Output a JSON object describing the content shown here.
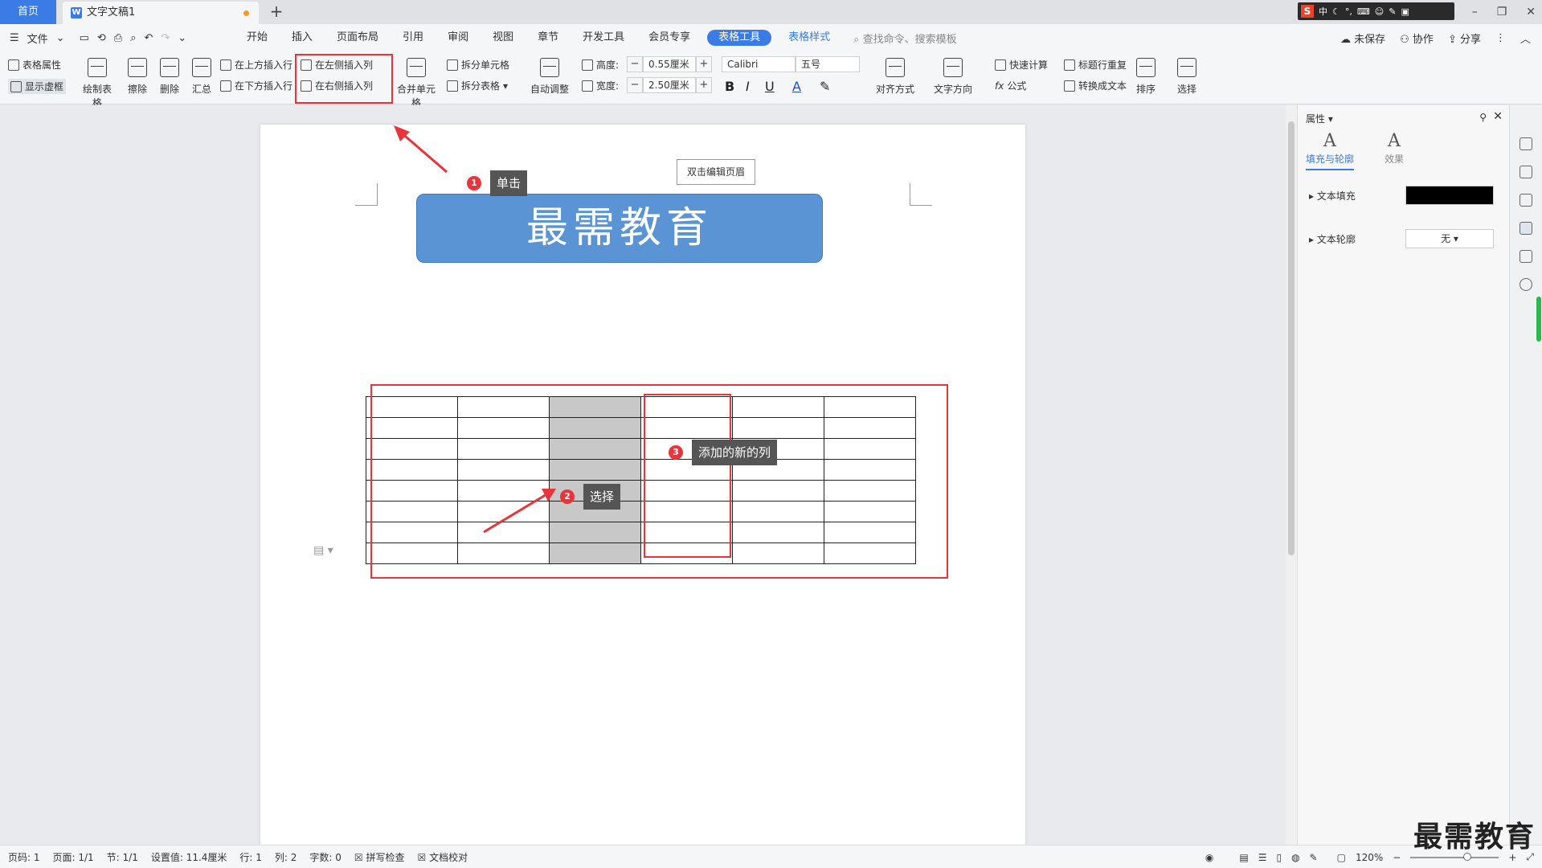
{
  "titlebar": {
    "home_tab": "首页",
    "doc_tab": "文字文稿1",
    "add_tab": "+",
    "ime": "中"
  },
  "menubar": {
    "file": "文件",
    "items": [
      "开始",
      "插入",
      "页面布局",
      "引用",
      "审阅",
      "视图",
      "章节",
      "开发工具",
      "会员专享",
      "表格工具",
      "表格样式"
    ],
    "search_placeholder": "查找命令、搜索模板",
    "unsaved": "未保存",
    "collab": "协作",
    "share": "分享"
  },
  "ribbon": {
    "table_props": "表格属性",
    "show_gridlines": "显示虚框",
    "draw_table": "绘制表格",
    "erase": "擦除",
    "delete": "删除",
    "summary": "汇总",
    "insert_above": "在上方插入行",
    "insert_below": "在下方插入行",
    "insert_left": "在左侧插入列",
    "insert_right": "在右侧插入列",
    "merge_cells": "合并单元格",
    "split_cells": "拆分单元格",
    "split_table": "拆分表格",
    "auto_fit": "自动调整",
    "height_label": "高度:",
    "height_value": "0.55厘米",
    "width_label": "宽度:",
    "width_value": "2.50厘米",
    "font_name": "Calibri",
    "font_size": "五号",
    "align": "对齐方式",
    "text_dir": "文字方向",
    "quick_calc": "快速计算",
    "repeat_header": "标题行重复",
    "formula": "公式",
    "to_text": "转换成文本",
    "sort": "排序",
    "select": "选择"
  },
  "document": {
    "header_hint": "双击编辑页眉",
    "banner_text": "最需教育"
  },
  "annotations": {
    "step1": {
      "num": "1",
      "label": "单击"
    },
    "step2": {
      "num": "2",
      "label": "选择"
    },
    "step3": {
      "num": "3",
      "label": "添加的新的列"
    }
  },
  "props": {
    "title": "属性",
    "tab_fill": "填充与轮廓",
    "tab_effect": "效果",
    "text_fill": "文本填充",
    "text_outline": "文本轮廓",
    "outline_value": "无"
  },
  "statusbar": {
    "page_num": "页码: 1",
    "pages": "页面: 1/1",
    "section": "节: 1/1",
    "setting": "设置值: 11.4厘米",
    "row": "行: 1",
    "col": "列: 2",
    "words": "字数: 0",
    "spell": "拼写检查",
    "proof": "文档校对",
    "zoom": "120%"
  },
  "watermark": "最需教育",
  "colors": {
    "accent": "#3b7be5",
    "annotation_red": "#e8343a",
    "banner_fill": "#5b94d4"
  }
}
